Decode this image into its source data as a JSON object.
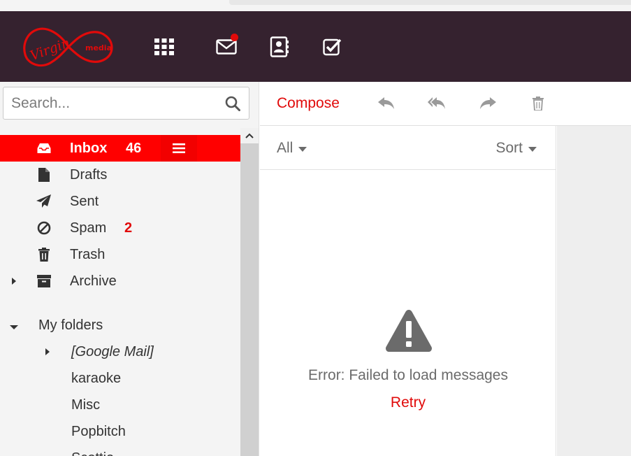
{
  "header": {
    "logo_text": "Virgin media",
    "nav": [
      "apps-grid",
      "mail",
      "contacts",
      "tasks"
    ]
  },
  "search": {
    "placeholder": "Search..."
  },
  "folders": [
    {
      "label": "Inbox",
      "count": "46",
      "icon": "inbox-icon",
      "active": true
    },
    {
      "label": "Drafts",
      "icon": "document-icon"
    },
    {
      "label": "Sent",
      "icon": "paper-plane-icon"
    },
    {
      "label": "Spam",
      "count": "2",
      "icon": "ban-icon"
    },
    {
      "label": "Trash",
      "icon": "trash-icon"
    },
    {
      "label": "Archive",
      "icon": "archive-box-icon"
    }
  ],
  "my_folders": {
    "label": "My folders",
    "items": [
      "[Google Mail]",
      "karaoke",
      "Misc",
      "Popbitch",
      "Scottie"
    ]
  },
  "toolbar": {
    "compose_label": "Compose",
    "actions": [
      "reply",
      "reply-all",
      "forward",
      "delete"
    ]
  },
  "list": {
    "filter_label": "All",
    "sort_label": "Sort",
    "error_message": "Error: Failed to load messages",
    "retry_label": "Retry"
  },
  "colors": {
    "brand_red": "#e10a0a",
    "header_bg": "#35222f",
    "active_folder_bg": "#ff0000"
  }
}
